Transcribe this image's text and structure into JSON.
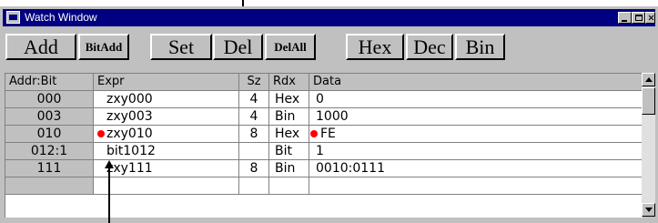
{
  "window": {
    "title": "Watch Window"
  },
  "toolbar": {
    "add": "Add",
    "bitadd": "BitAdd",
    "set": "Set",
    "del": "Del",
    "delall": "DelAll",
    "hex": "Hex",
    "dec": "Dec",
    "bin": "Bin"
  },
  "columns": {
    "addr": "Addr:Bit",
    "expr": "Expr",
    "sz": "Sz",
    "rdx": "Rdx",
    "data": "Data"
  },
  "rows": [
    {
      "addr": "000",
      "expr": "zxy000",
      "sz": "4",
      "rdx": "Hex",
      "data": "0",
      "marked": false
    },
    {
      "addr": "003",
      "expr": "zxy003",
      "sz": "4",
      "rdx": "Bin",
      "data": "1000",
      "marked": false
    },
    {
      "addr": "010",
      "expr": "zxy010",
      "sz": "8",
      "rdx": "Hex",
      "data": "FE",
      "marked": true
    },
    {
      "addr": "012:1",
      "expr": "bit1012",
      "sz": "",
      "rdx": "Bit",
      "data": "1",
      "marked": false
    },
    {
      "addr": "111",
      "expr": "zxy111",
      "sz": "8",
      "rdx": "Bin",
      "data": "0010:0111",
      "marked": false
    },
    {
      "addr": "",
      "expr": "",
      "sz": "",
      "rdx": "",
      "data": "",
      "marked": false
    }
  ],
  "colors": {
    "titlebar": "#000080",
    "marker": "#ff0000",
    "face": "#c0c0c0"
  }
}
